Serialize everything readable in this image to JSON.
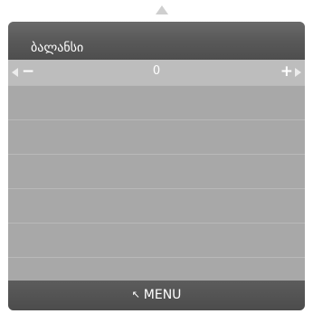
{
  "header": {
    "title": "ბალანსი"
  },
  "slider": {
    "value": "0",
    "minus_label": "−",
    "plus_label": "+"
  },
  "footer": {
    "menu_icon": "↖",
    "menu_label": "MENU"
  },
  "colors": {
    "panel_background": "#a4a4a4",
    "header_background": "#5a5a5a",
    "selected_row": "#bdbdbd",
    "text": "#ffffff"
  },
  "icons": {
    "scroll_up": "triangle-up-icon",
    "left": "triangle-left-icon",
    "right": "triangle-right-icon",
    "menu": "return-arrow-icon"
  }
}
